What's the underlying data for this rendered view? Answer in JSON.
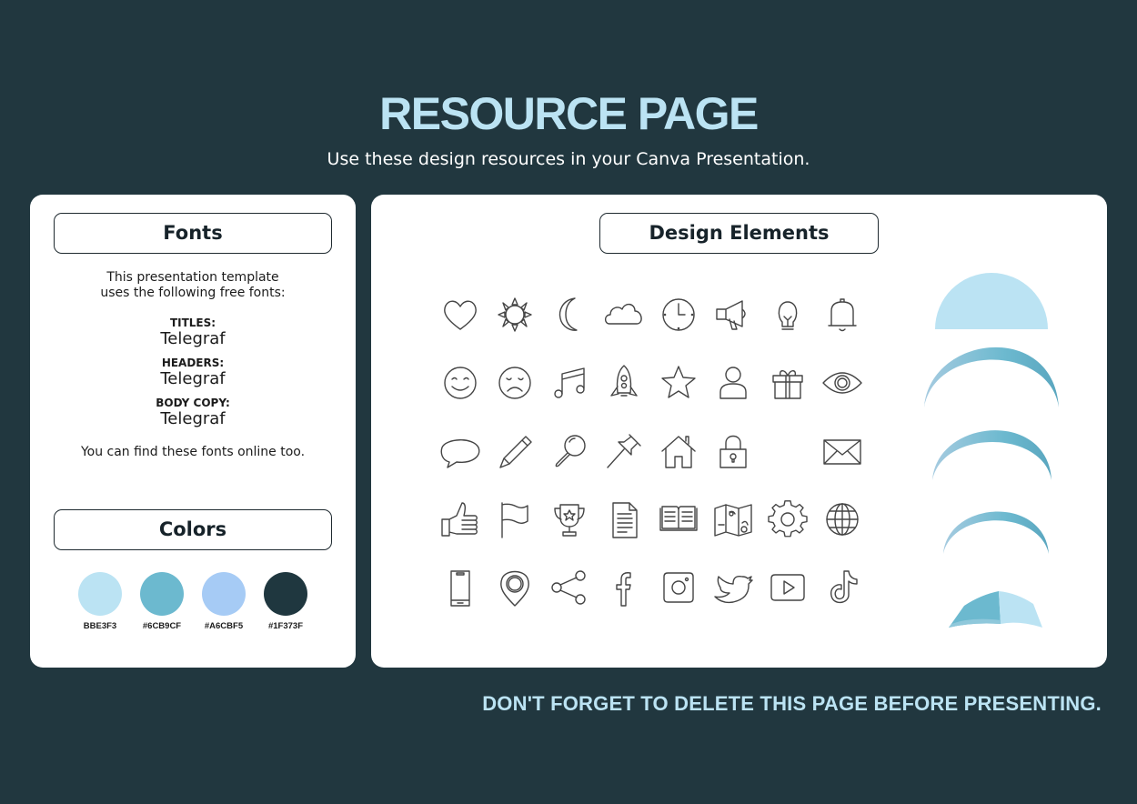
{
  "header": {
    "title": "RESOURCE PAGE",
    "subtitle": "Use these design resources in your Canva Presentation."
  },
  "fonts_card": {
    "heading": "Fonts",
    "intro_line1": "This presentation template",
    "intro_line2": "uses the following free fonts:",
    "entries": [
      {
        "label": "TITLES:",
        "font": "Telegraf"
      },
      {
        "label": "HEADERS:",
        "font": "Telegraf"
      },
      {
        "label": "BODY COPY:",
        "font": "Telegraf"
      }
    ],
    "outro": "You can find these fonts online too."
  },
  "colors_card": {
    "heading": "Colors",
    "swatches": [
      {
        "label": "BBE3F3",
        "color": "#BBE3F3"
      },
      {
        "label": "#6CB9CF",
        "color": "#6CB9CF"
      },
      {
        "label": "#A6CBF5",
        "color": "#A6CBF5"
      },
      {
        "label": "#1F373F",
        "color": "#1F373F"
      }
    ]
  },
  "design_card": {
    "heading": "Design Elements",
    "icons": [
      "heart-icon",
      "sun-icon",
      "moon-icon",
      "cloud-icon",
      "clock-icon",
      "megaphone-icon",
      "lightbulb-icon",
      "bell-icon",
      "smiley-icon",
      "sad-face-icon",
      "music-note-icon",
      "rocket-icon",
      "star-icon",
      "user-icon",
      "gift-icon",
      "eye-icon",
      "speech-bubble-icon",
      "pencil-icon",
      "magnifier-icon",
      "pushpin-icon",
      "home-icon",
      "padlock-icon",
      "envelope-icon",
      "thumbs-up-icon",
      "flag-icon",
      "trophy-icon",
      "document-icon",
      "open-book-icon",
      "map-icon",
      "gear-icon",
      "globe-icon",
      "smartphone-icon",
      "location-pin-icon",
      "share-icon",
      "facebook-icon",
      "instagram-icon",
      "twitter-icon",
      "youtube-icon",
      "tiktok-icon"
    ],
    "shapes": [
      "half-circle-shape",
      "arc-shape-large",
      "arc-shape-medium",
      "arc-shape-small",
      "wave-fold-shape"
    ]
  },
  "footer": {
    "notice": "DON'T FORGET TO DELETE THIS PAGE BEFORE PRESENTING."
  }
}
